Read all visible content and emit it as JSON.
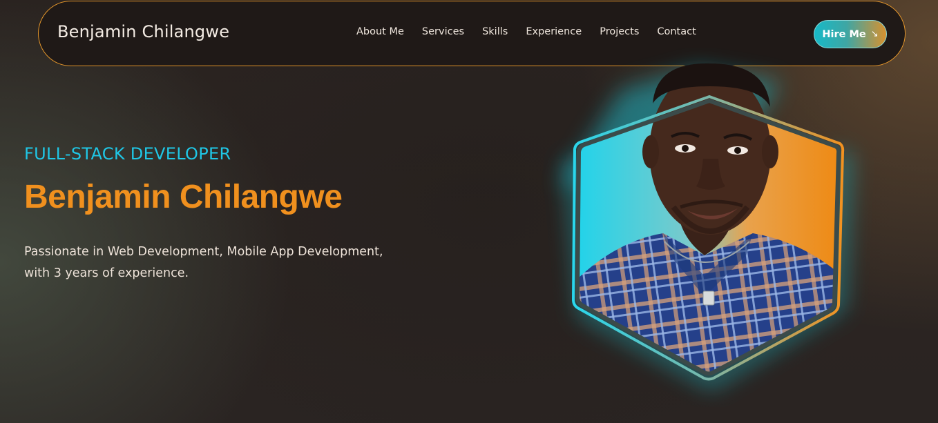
{
  "navbar": {
    "brand": "Benjamin Chilangwe",
    "links": [
      "About Me",
      "Services",
      "Skills",
      "Experience",
      "Projects",
      "Contact"
    ],
    "hire_label": "Hire Me",
    "hire_icon": "arrow-down-right-icon"
  },
  "hero": {
    "role": "FULL-STACK DEVELOPER",
    "name": "Benjamin Chilangwe",
    "tagline_line1": "Passionate in Web Development, Mobile App Development,",
    "tagline_line2": "with 3 years of experience."
  },
  "colors": {
    "accent_orange": "#f0901e",
    "accent_cyan": "#1fc7e6",
    "background": "#2b2421",
    "nav_border": "#e3952a"
  }
}
